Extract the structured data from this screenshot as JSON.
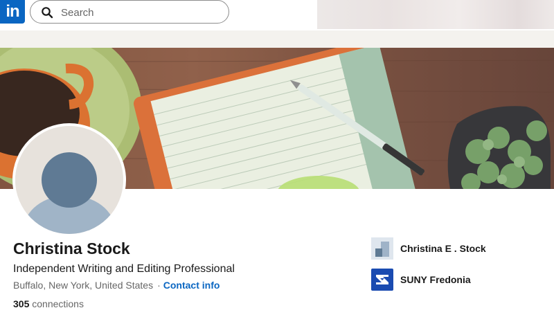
{
  "brand": {
    "logo_text": "in",
    "color": "#0a66c2"
  },
  "search": {
    "placeholder": "Search",
    "value": ""
  },
  "profile": {
    "name": "Christina Stock",
    "headline": "Independent Writing and Editing Professional",
    "location": "Buffalo, New York, United States",
    "separator": "·",
    "contact_label": "Contact info",
    "connections_count": "305",
    "connections_label": "connections"
  },
  "orgs": [
    {
      "name": "Christina E . Stock",
      "icon": "company-logo-placeholder"
    },
    {
      "name": "SUNY Fredonia",
      "icon": "suny-fredonia-logo"
    }
  ],
  "icons": {
    "search": "search-icon",
    "avatar": "default-avatar-icon"
  },
  "colors": {
    "link": "#0a66c2",
    "avatar_bg": "#e7e2dc",
    "avatar_person": "#a0b4c7",
    "suny_blue": "#1a4bb1"
  }
}
